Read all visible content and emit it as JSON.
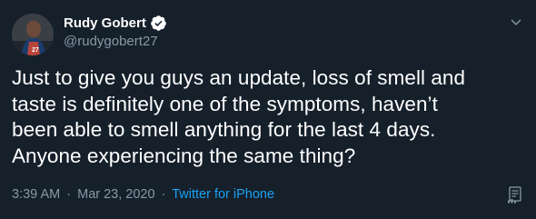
{
  "author": {
    "display_name": "Rudy Gobert",
    "handle": "@rudygobert27",
    "verified": true,
    "avatar_icon": "profile-photo"
  },
  "tweet": {
    "lines": [
      "Just to give you guys an update, loss of smell and",
      "taste is definitely one of the symptoms, haven’t",
      "been able to smell anything for the last 4 days.",
      "Anyone experiencing the same thing?"
    ]
  },
  "meta": {
    "time": "3:39 AM",
    "separator": "·",
    "date": "Mar 23, 2020",
    "source": "Twitter for iPhone"
  },
  "icons": {
    "more": "chevron-down-icon",
    "verified": "verified-badge-icon",
    "analytics": "analytics-icon"
  },
  "colors": {
    "background": "#15202b",
    "text_primary": "#ffffff",
    "text_secondary": "#8899a6",
    "accent": "#1da1f2"
  }
}
